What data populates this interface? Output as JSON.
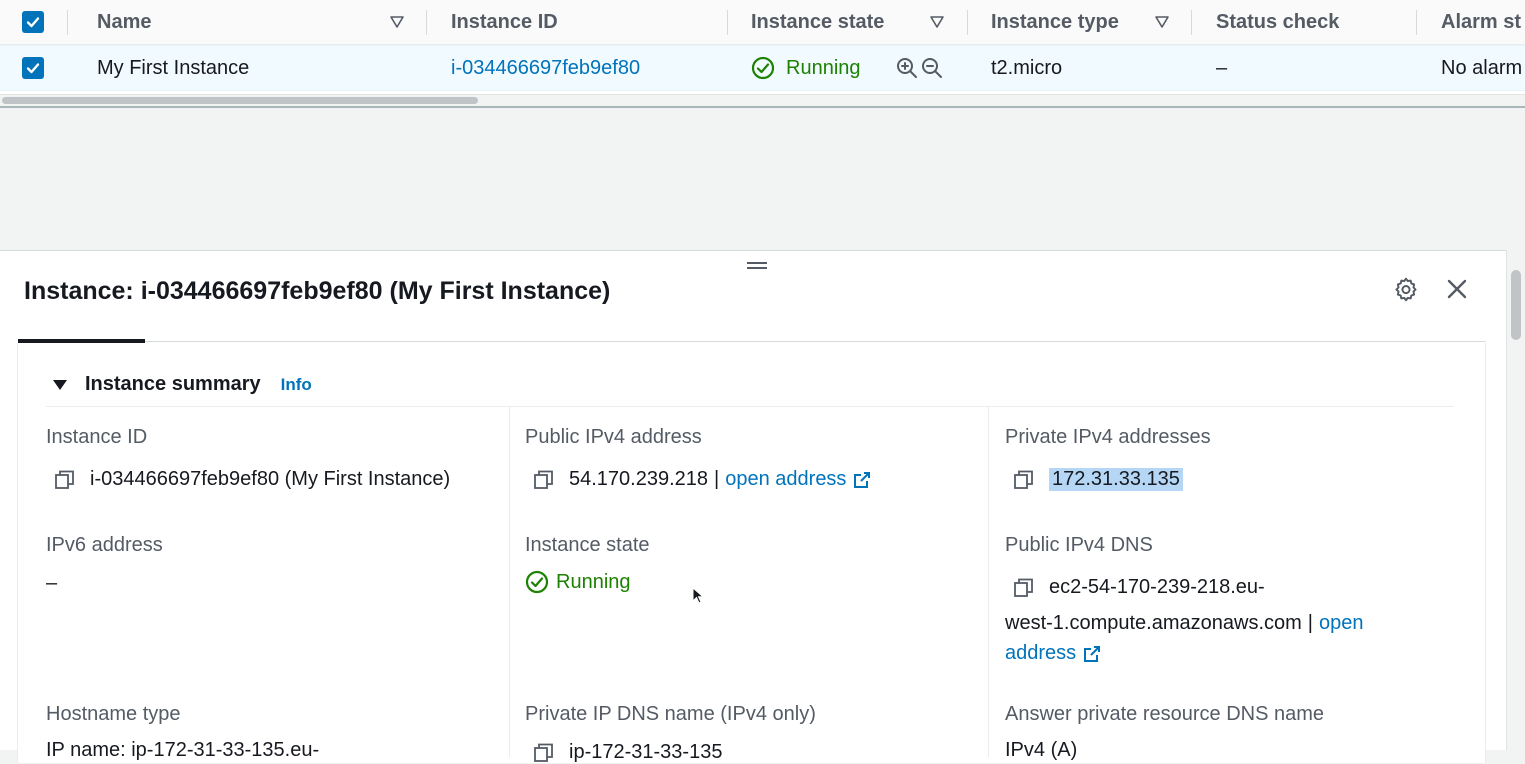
{
  "table": {
    "columns": [
      "Name",
      "Instance ID",
      "Instance state",
      "Instance type",
      "Status check",
      "Alarm st"
    ],
    "row": {
      "name": "My First Instance",
      "instance_id": "i-034466697feb9ef80",
      "state": "Running",
      "type": "t2.micro",
      "status_check": "–",
      "alarm": "No alarm"
    }
  },
  "detail": {
    "title": "Instance: i-034466697feb9ef80 (My First Instance)",
    "summary_header": "Instance summary",
    "info_label": "Info",
    "fields": {
      "instance_id_label": "Instance ID",
      "instance_id_value": "i-034466697feb9ef80 (My First Instance)",
      "public_ipv4_label": "Public IPv4 address",
      "public_ipv4_value": "54.170.239.218",
      "public_ipv4_sep": "|",
      "open_address": "open address",
      "private_ipv4_label": "Private IPv4 addresses",
      "private_ipv4_value": "172.31.33.135",
      "ipv6_label": "IPv6 address",
      "ipv6_value": "–",
      "state_label": "Instance state",
      "state_value": "Running",
      "public_dns_label": "Public IPv4 DNS",
      "public_dns_line1": "ec2-54-170-239-218.eu-",
      "public_dns_line2": "west-1.compute.amazonaws.com",
      "public_dns_sep": "|",
      "open_word": "open",
      "address_word": "address",
      "hostname_label": "Hostname type",
      "hostname_value_partial": "IP name: ip-172-31-33-135.eu-",
      "private_dns_label": "Private IP DNS name (IPv4 only)",
      "private_dns_value_partial": "ip-172-31-33-135",
      "answer_dns_label": "Answer private resource DNS name",
      "answer_dns_value_partial": "IPv4 (A)"
    }
  },
  "colors": {
    "link": "#0073bb",
    "running": "#1d8102",
    "selected_row": "#f1faff",
    "highlight": "#b5d7f5"
  },
  "icons": [
    "checkbox-icon",
    "filter-icon",
    "check-circle-icon",
    "zoom-in-icon",
    "zoom-out-icon",
    "gear-icon",
    "close-icon",
    "copy-icon",
    "external-link-icon",
    "caret-down-icon",
    "drag-handle-icon",
    "mouse-cursor-icon"
  ]
}
